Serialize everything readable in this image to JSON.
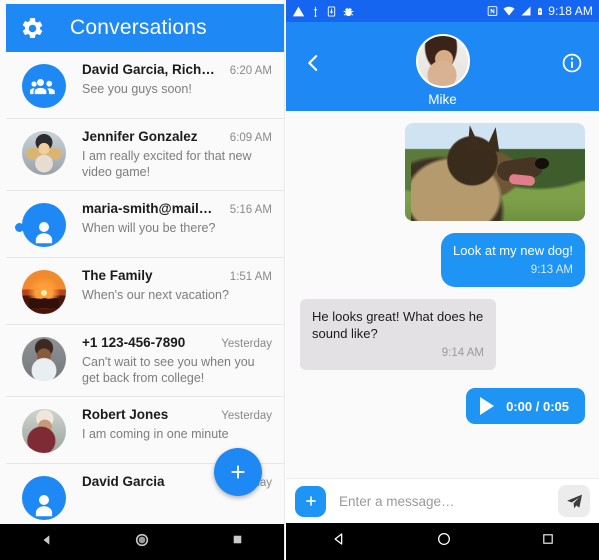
{
  "conversations_panel": {
    "appbar": {
      "settings_icon": "gear-icon",
      "title": "Conversations"
    },
    "fab": {
      "icon": "plus-icon",
      "label": "+"
    },
    "items": [
      {
        "name": "David Garcia, Rich…",
        "time": "6:20 AM",
        "snippet": "See you guys soon!",
        "avatar_type": "group-icon",
        "unread": false
      },
      {
        "name": "Jennifer Gonzalez",
        "time": "6:09 AM",
        "snippet": "I am really excited for that new video game!",
        "avatar_type": "photo",
        "unread": false
      },
      {
        "name": "maria-smith@mail…",
        "time": "5:16 AM",
        "snippet": "When will you be there?",
        "avatar_type": "person-icon",
        "unread": true
      },
      {
        "name": "The Family",
        "time": "1:51 AM",
        "snippet": "When's our next vacation?",
        "avatar_type": "photo",
        "unread": false
      },
      {
        "name": "+1 123-456-7890",
        "time": "Yesterday",
        "snippet": "Can't wait to see you when you get back from college!",
        "avatar_type": "photo",
        "unread": false
      },
      {
        "name": "Robert Jones",
        "time": "Yesterday",
        "snippet": "I am coming in one minute",
        "avatar_type": "photo",
        "unread": false
      },
      {
        "name": "David Garcia",
        "time": "Yesterday",
        "snippet": "",
        "avatar_type": "person-icon",
        "unread": false
      }
    ]
  },
  "chat_panel": {
    "statusbar": {
      "left_icons": [
        "warning-triangle-icon",
        "usb-icon",
        "download-box-icon",
        "bug-icon"
      ],
      "right_icons": [
        "nfc-icon",
        "wifi-icon",
        "cell-signal-icon",
        "battery-icon"
      ],
      "clock": "9:18 AM"
    },
    "header": {
      "back_icon": "chevron-left-icon",
      "info_icon": "info-circle-icon",
      "contact_name": "Mike",
      "avatar": "contact-avatar"
    },
    "messages": [
      {
        "kind": "image",
        "direction": "out",
        "alt": "german-shepherd-dog-photo"
      },
      {
        "kind": "text",
        "direction": "out",
        "text": "Look at my new dog!",
        "time": "9:13 AM"
      },
      {
        "kind": "text",
        "direction": "in",
        "text": "He looks great! What does he sound like?",
        "time": "9:14 AM"
      },
      {
        "kind": "audio",
        "direction": "out",
        "play_icon": "play-icon",
        "duration": "0:00 / 0:05"
      }
    ],
    "composer": {
      "attach_label": "+",
      "placeholder": "Enter a message…",
      "input_value": "",
      "send_icon": "send-paper-plane-icon"
    }
  },
  "navbar": {
    "back_icon": "nav-back-triangle-icon",
    "home_icon": "nav-home-circle-icon",
    "recents_icon": "nav-recents-square-icon"
  },
  "colors": {
    "primary_blue": "#1e88f5",
    "status_blue": "#1565f0",
    "bubble_out": "#1e95f5",
    "bubble_in": "#e3e1e4",
    "panel_bg": "#fafafa",
    "navbar_black": "#000000"
  }
}
